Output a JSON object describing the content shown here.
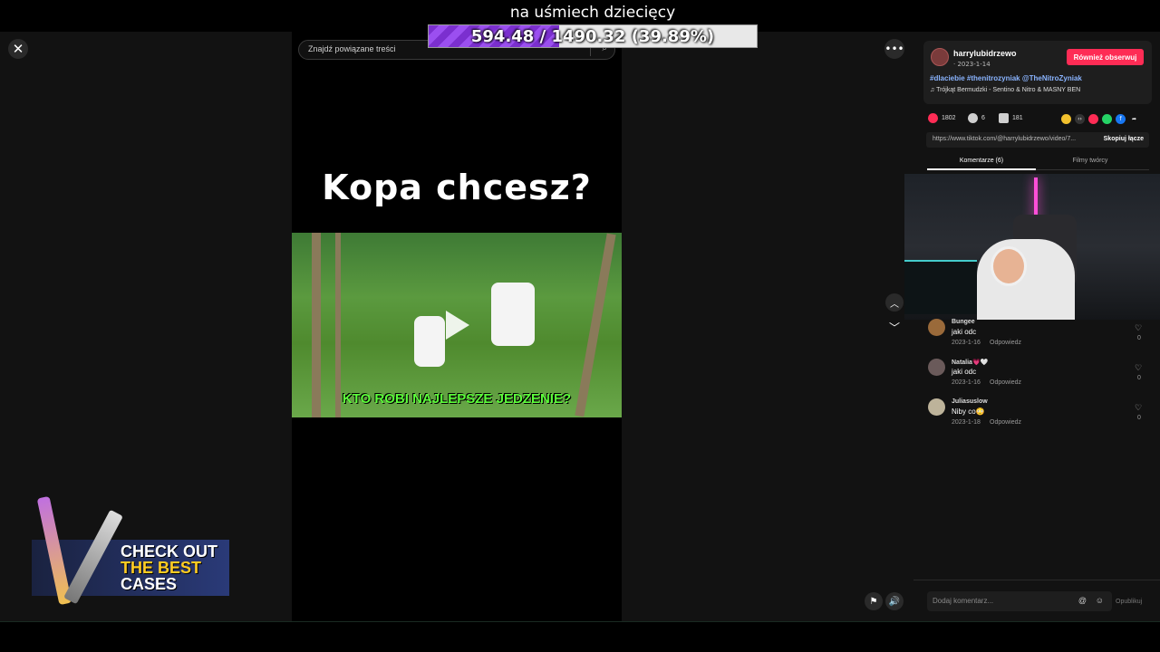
{
  "overlay": {
    "title": "na uśmiech dziecięcy",
    "progress_text": "594.48 / 1490.32 (39.89%)",
    "progress_fraction": 0.3989
  },
  "viewer": {
    "search_placeholder": "Znajdź powiązane treści",
    "video_heading": "Kopa  chcesz?",
    "video_caption": "KTO ROBI NAJLEPSZE JEDZENIE?"
  },
  "ad": {
    "line1": "CHECK OUT",
    "line2": "THE BEST",
    "line3": "CASES"
  },
  "author": {
    "name": "harrylubidrzewo",
    "date": "· 2023-1-14",
    "follow_label": "Również obserwuj",
    "hashtags": "#dlaciebie #thenitrozyniak @TheNitroZyniak",
    "music": "♫  Trójkąt Bermudzki - Sentino & Nitro & MASNY BEN"
  },
  "stats": {
    "likes": "1802",
    "comments": "6",
    "saves": "181"
  },
  "link": {
    "url": "https://www.tiktok.com/@harrylubidrzewo/video/7...",
    "copy_label": "Skopiuj łącze"
  },
  "tabs": {
    "comments": "Komentarze (6)",
    "creator_videos": "Filmy twórcy"
  },
  "comments": [
    {
      "user": "Bungee",
      "text": "jaki odc",
      "date": "2023-1-16",
      "reply": "Odpowiedz",
      "likes": "0"
    },
    {
      "user": "Natalia💗🤍",
      "text": "jaki odc",
      "date": "2023-1-16",
      "reply": "Odpowiedz",
      "likes": "0"
    },
    {
      "user": "Juliasuslow",
      "text": "Niby co😳",
      "date": "2023-1-18",
      "reply": "Odpowiedz",
      "likes": "0"
    }
  ],
  "composer": {
    "placeholder": "Dodaj komentarz...",
    "publish_label": "Opublikuj"
  },
  "colors": {
    "accent": "#fe2c55",
    "progress": "#8a3de0",
    "caption": "#5cff3a"
  }
}
